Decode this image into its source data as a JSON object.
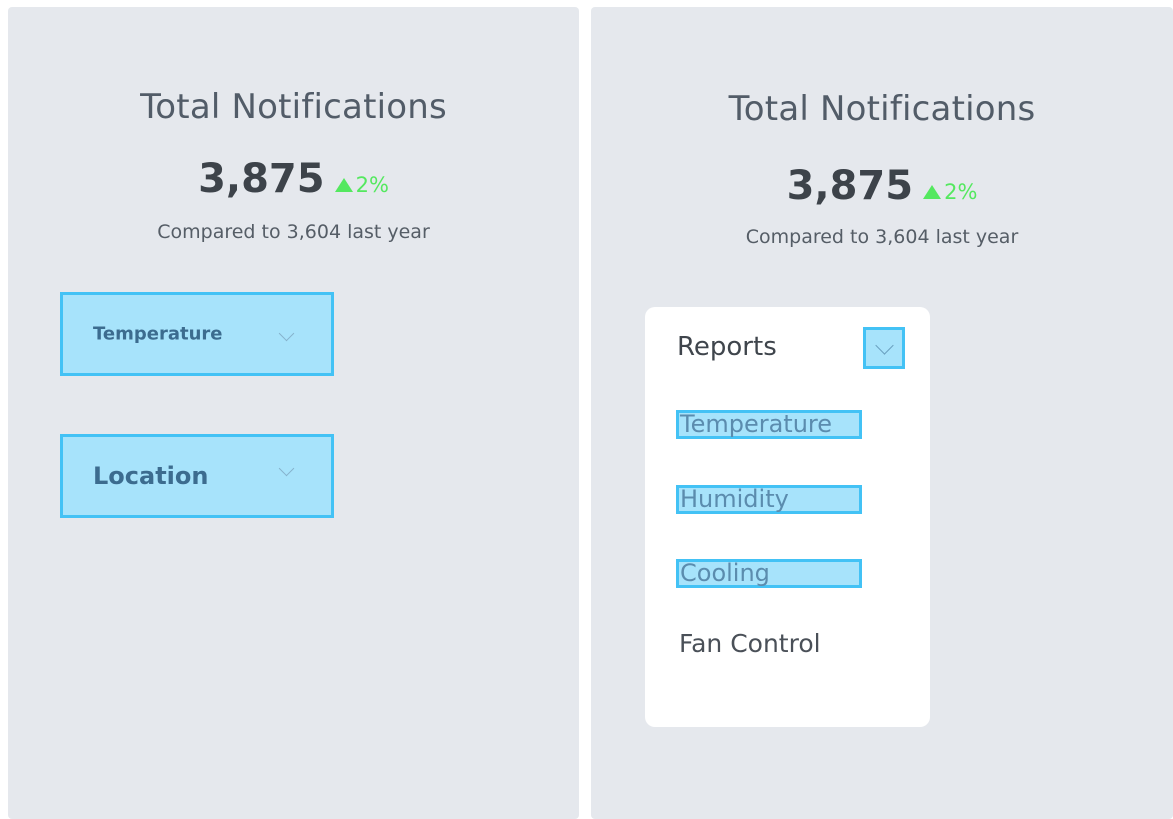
{
  "left_panel": {
    "title": "Total Notifications",
    "value": "3,875",
    "delta": "2%",
    "comparison": "Compared to 3,604 last year",
    "dropdowns": [
      {
        "label": "Temperature"
      },
      {
        "label": "Location"
      }
    ]
  },
  "right_panel": {
    "title": "Total Notifications",
    "value": "3,875",
    "delta": "2%",
    "comparison": "Compared to 3,604 last year",
    "menu": {
      "title": "Reports",
      "items": [
        {
          "label": "Temperature",
          "highlighted": true
        },
        {
          "label": "Humidity",
          "highlighted": true
        },
        {
          "label": "Cooling",
          "highlighted": true
        },
        {
          "label": "Fan Control",
          "highlighted": false
        }
      ]
    }
  },
  "colors": {
    "panel_bg": "#e5e8ed",
    "highlight_fill": "#a7e3fb",
    "highlight_border": "#43c2f5",
    "positive_delta": "#54e85f"
  }
}
